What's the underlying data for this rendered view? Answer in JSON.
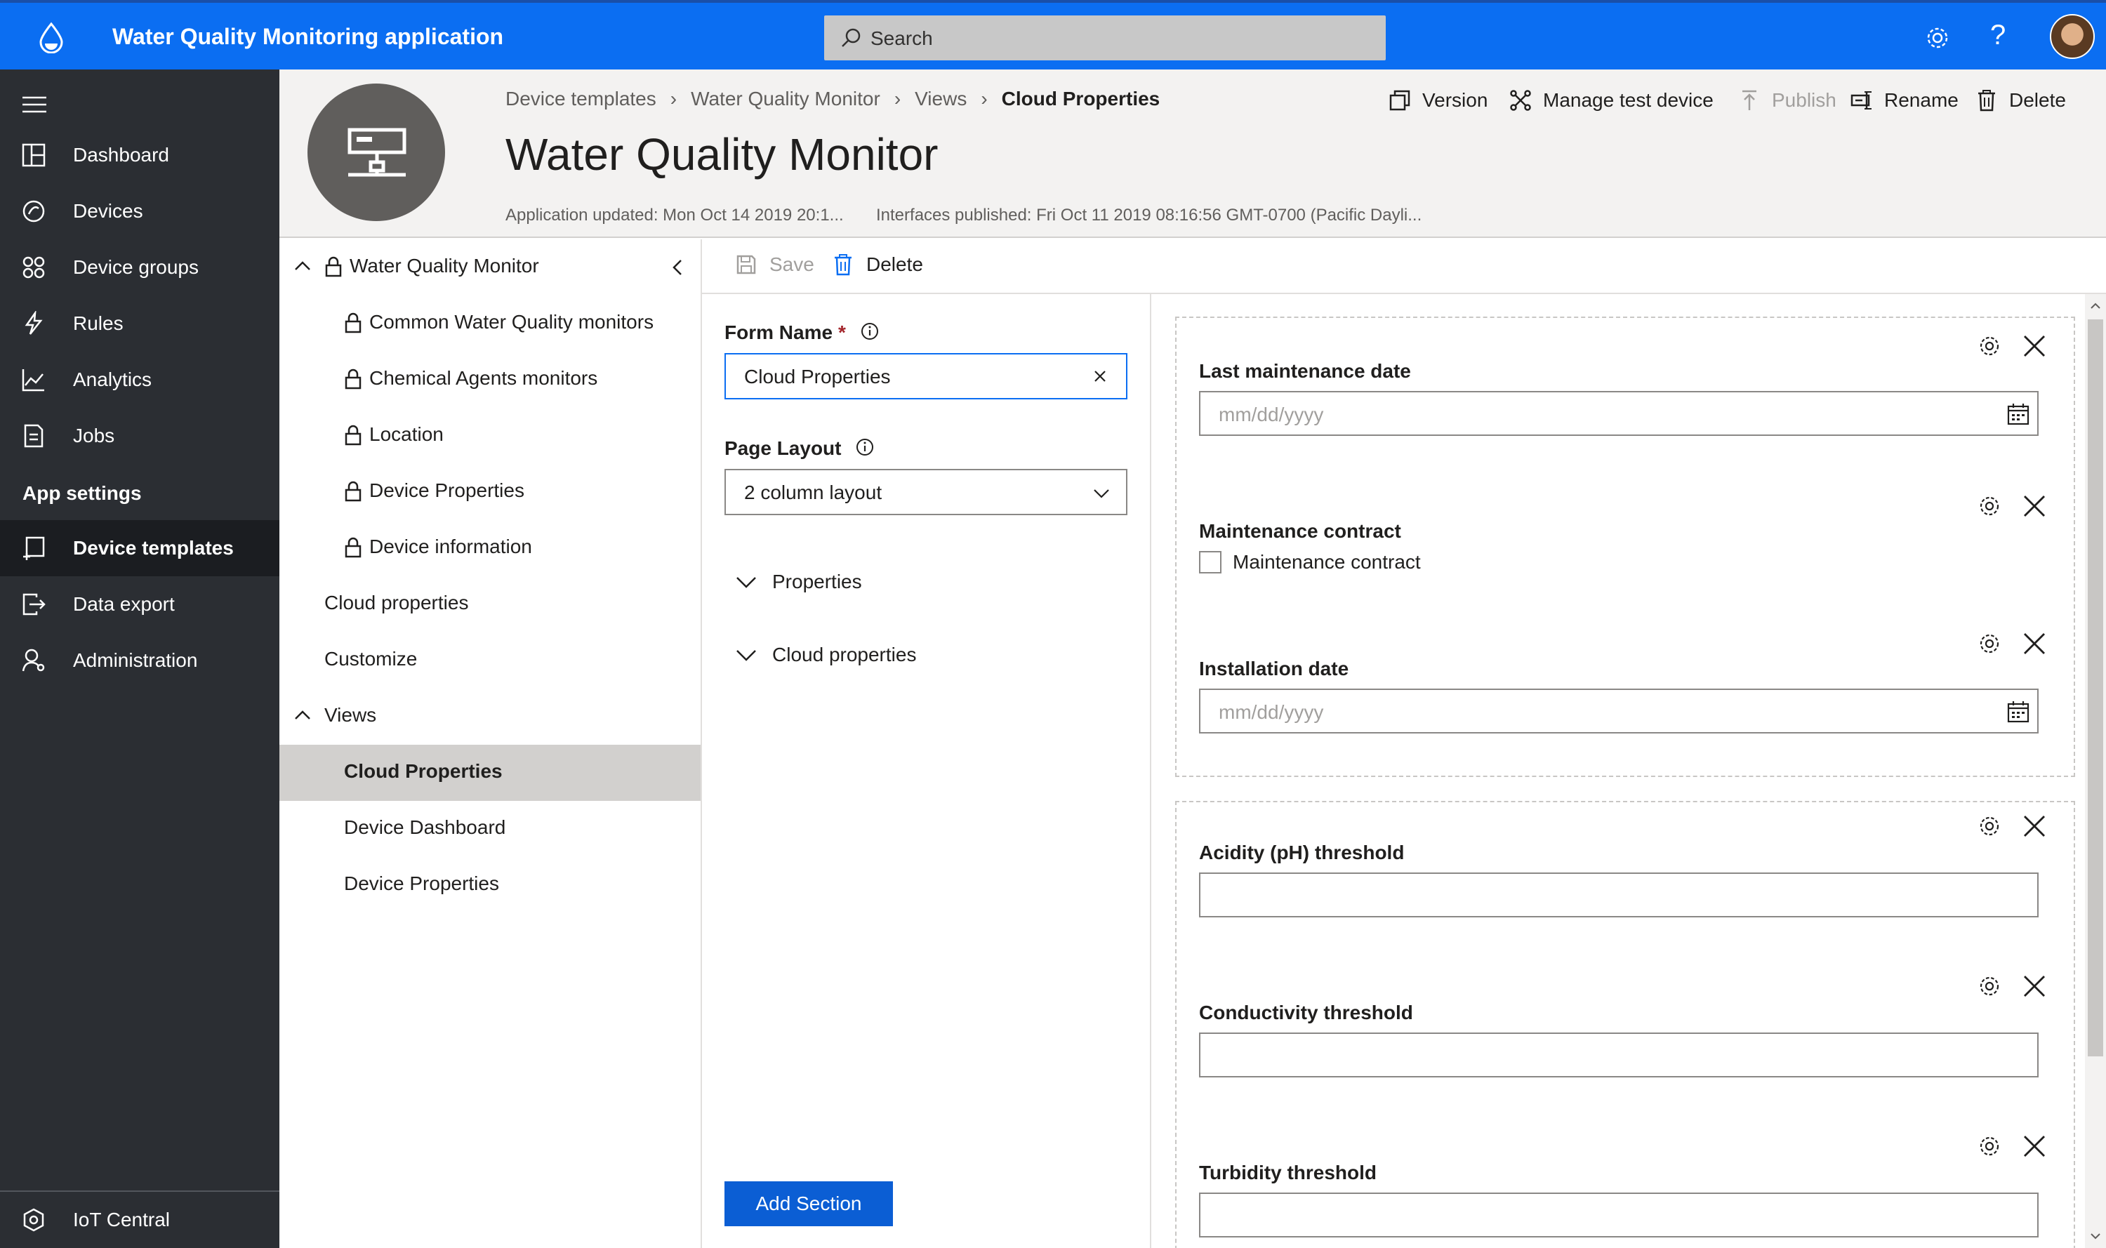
{
  "app": {
    "title": "Water Quality Monitoring application"
  },
  "search": {
    "placeholder": "Search"
  },
  "topbar_icons": [
    "gear-icon",
    "help-icon",
    "avatar"
  ],
  "nav": {
    "items": [
      {
        "label": "Dashboard",
        "icon": "dashboard-icon"
      },
      {
        "label": "Devices",
        "icon": "devices-icon"
      },
      {
        "label": "Device groups",
        "icon": "device-groups-icon"
      },
      {
        "label": "Rules",
        "icon": "rules-icon"
      },
      {
        "label": "Analytics",
        "icon": "analytics-icon"
      },
      {
        "label": "Jobs",
        "icon": "jobs-icon"
      }
    ],
    "section_label": "App settings",
    "settings_items": [
      {
        "label": "Device templates",
        "icon": "device-templates-icon",
        "active": true
      },
      {
        "label": "Data export",
        "icon": "data-export-icon"
      },
      {
        "label": "Administration",
        "icon": "administration-icon"
      }
    ],
    "footer_label": "IoT Central"
  },
  "header": {
    "breadcrumbs": [
      "Device templates",
      "Water Quality Monitor",
      "Views",
      "Cloud Properties"
    ],
    "title": "Water Quality Monitor",
    "app_updated": "Application updated: Mon Oct 14 2019 20:1...",
    "interfaces_published": "Interfaces published: Fri Oct 11 2019 08:16:56 GMT-0700 (Pacific Dayli...",
    "commands": {
      "version": "Version",
      "manage_test_device": "Manage test device",
      "publish": "Publish",
      "rename": "Rename",
      "delete": "Delete"
    }
  },
  "tree": {
    "root": "Water Quality Monitor",
    "interfaces": [
      "Common Water Quality monitors",
      "Chemical Agents monitors",
      "Location",
      "Device Properties",
      "Device information"
    ],
    "cloud_properties": "Cloud properties",
    "customize": "Customize",
    "views_label": "Views",
    "views": [
      "Cloud Properties",
      "Device Dashboard",
      "Device Properties"
    ]
  },
  "toolbar": {
    "save": "Save",
    "delete": "Delete"
  },
  "form": {
    "form_name_label": "Form Name",
    "required_mark": "*",
    "form_name_value": "Cloud Properties",
    "page_layout_label": "Page Layout",
    "page_layout_value": "2 column layout",
    "expanders": [
      "Properties",
      "Cloud properties"
    ],
    "add_section": "Add Section"
  },
  "canvas": {
    "sections": [
      {
        "fields": [
          {
            "label": "Last maintenance date",
            "type": "date",
            "placeholder": "mm/dd/yyyy"
          },
          {
            "label": "Maintenance contract",
            "type": "checkbox",
            "checkbox_label": "Maintenance contract"
          },
          {
            "label": "Installation date",
            "type": "date",
            "placeholder": "mm/dd/yyyy"
          }
        ]
      },
      {
        "fields": [
          {
            "label": "Acidity (pH) threshold",
            "type": "text"
          },
          {
            "label": "Conductivity threshold",
            "type": "text"
          },
          {
            "label": "Turbidity threshold",
            "type": "text"
          }
        ]
      }
    ]
  },
  "colors": {
    "topbar": "#0b6ef2",
    "nav_bg": "#2b2e33",
    "primary_button": "#0b5ed4",
    "selected_tree": "#d2d0ce"
  }
}
